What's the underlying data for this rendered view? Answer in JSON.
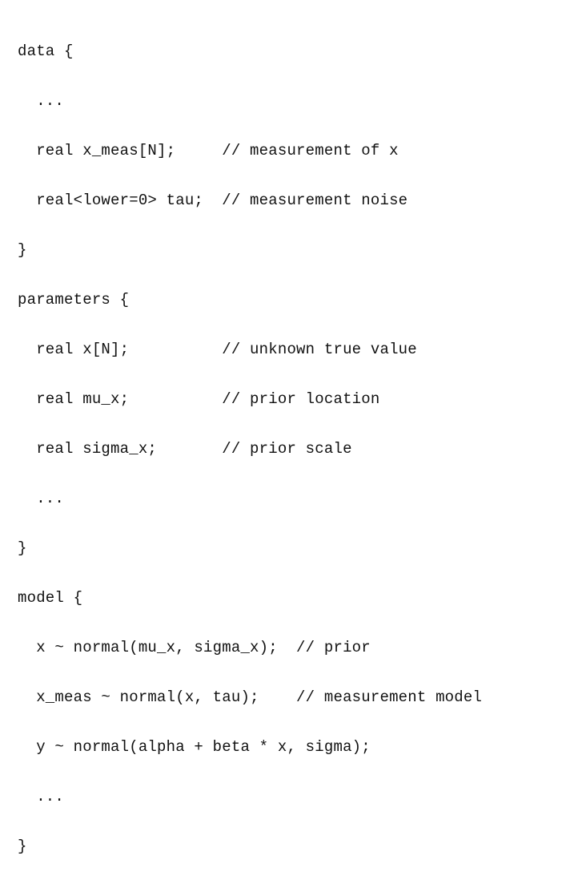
{
  "code": {
    "lines": [
      "data {",
      "  ...",
      "  real x_meas[N];     // measurement of x",
      "  real<lower=0> tau;  // measurement noise",
      "}",
      "parameters {",
      "  real x[N];          // unknown true value",
      "  real mu_x;          // prior location",
      "  real sigma_x;       // prior scale",
      "  ...",
      "}",
      "model {",
      "  x ~ normal(mu_x, sigma_x);  // prior",
      "  x_meas ~ normal(x, tau);    // measurement model",
      "  y ~ normal(alpha + beta * x, sigma);",
      "  ...",
      "}"
    ]
  }
}
